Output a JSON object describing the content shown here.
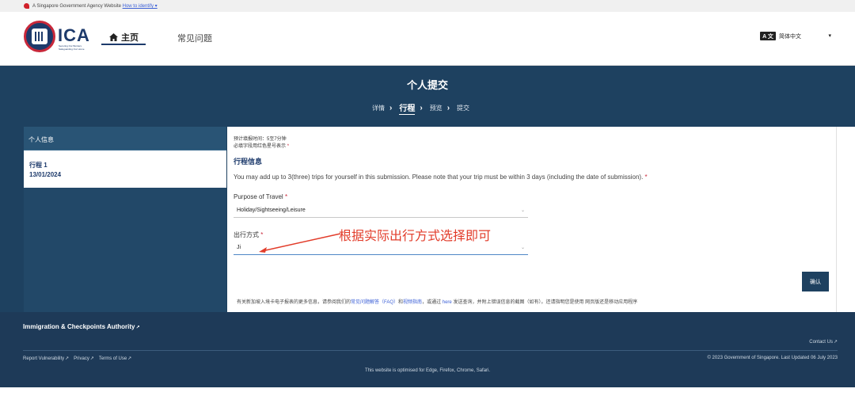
{
  "masthead": {
    "text": "A Singapore Government Agency Website",
    "link": "How to identify ▾"
  },
  "header": {
    "logo_text": "ICA",
    "logo_tagline": "Securing Our Borders Safeguarding Our Home",
    "nav_home": "主页",
    "nav_faq": "常见问题",
    "language_icon": "A 文",
    "language_selected": "简体中文",
    "language_caret": "▾"
  },
  "hero": {
    "title": "个人提交",
    "steps": [
      {
        "label": "详情"
      },
      {
        "label": "行程"
      },
      {
        "label": "预览"
      },
      {
        "label": "提交"
      }
    ]
  },
  "sidebar": {
    "header": "个人信息",
    "trip_label": "行程 1",
    "trip_date": "13/01/2024"
  },
  "form": {
    "estimated_time": "预计填报时间：5至7分钟",
    "required_note": "必填字段用红色星号表示",
    "required_mark": "*",
    "section_title": "行程信息",
    "trip_note": "You may add up to 3(three) trips for yourself in this submission. Please note that your trip must be within 3 days (including the date of submission).",
    "purpose_label": "Purpose of Travel",
    "purpose_value": "Holiday/Sightseeing/Leisure",
    "mode_label": "出行方式",
    "mode_value": "Ji",
    "confirm_label": "确认",
    "footnote_prefix": "有关新加坡入境卡电子报表的更多信息，请参阅我们的",
    "footnote_faq": "常见问题解答（FAQ）",
    "footnote_and": "和",
    "footnote_guide": "视频指南",
    "footnote_mid": "，或通过",
    "footnote_here": "here",
    "footnote_suffix": "发送查询，并附上错误信息的截图（如有）。还请指明您是使用 网页版还是移动应用程序"
  },
  "annotation": {
    "text": "根据实际出行方式选择即可",
    "color": "#e23c2a"
  },
  "footer": {
    "brand": "Immigration & Checkpoints Authority",
    "contact": "Contact Us",
    "links": [
      "Report Vulnerability",
      "Privacy",
      "Terms of Use"
    ],
    "copyright": "© 2023 Government of Singapore. Last Updated 06 July 2023",
    "optimised": "This website is optimised for Edge, Firefox, Chrome, Safari."
  },
  "colors": {
    "navy": "#1e4160",
    "brand_blue": "#1d3a6b",
    "required_red": "#c8283a"
  }
}
